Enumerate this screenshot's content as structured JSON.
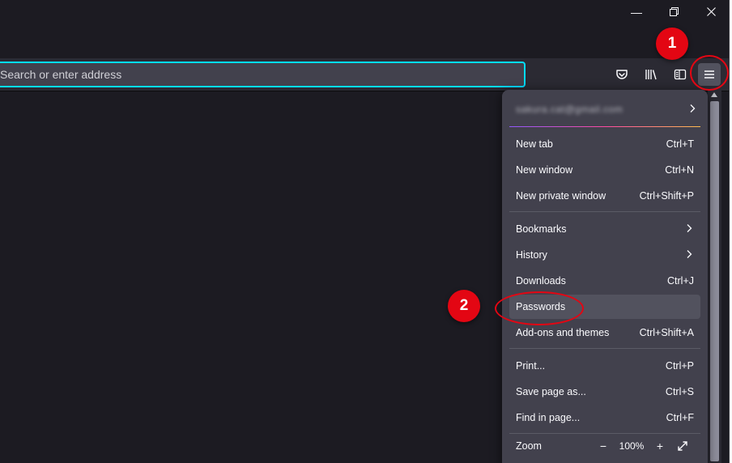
{
  "window_controls": {
    "minimize": "—",
    "restore": "❐",
    "close": "✕"
  },
  "urlbar": {
    "placeholder": "Search or enter address"
  },
  "toolbar_icons": [
    "pocket-icon",
    "library-icon",
    "sidebar-icon",
    "hamburger-menu-icon"
  ],
  "menu": {
    "account_email": "sakura.cat@gmail.com",
    "items_group1": [
      {
        "label": "New tab",
        "shortcut": "Ctrl+T"
      },
      {
        "label": "New window",
        "shortcut": "Ctrl+N"
      },
      {
        "label": "New private window",
        "shortcut": "Ctrl+Shift+P"
      }
    ],
    "items_group2": [
      {
        "label": "Bookmarks",
        "shortcut": ""
      },
      {
        "label": "History",
        "shortcut": ""
      },
      {
        "label": "Downloads",
        "shortcut": "Ctrl+J"
      },
      {
        "label": "Passwords",
        "shortcut": ""
      },
      {
        "label": "Add-ons and themes",
        "shortcut": "Ctrl+Shift+A"
      }
    ],
    "items_group3": [
      {
        "label": "Print...",
        "shortcut": "Ctrl+P"
      },
      {
        "label": "Save page as...",
        "shortcut": "Ctrl+S"
      },
      {
        "label": "Find in page...",
        "shortcut": "Ctrl+F"
      }
    ],
    "zoom": {
      "label": "Zoom",
      "minus": "−",
      "value": "100%",
      "plus": "+"
    }
  },
  "annotations": {
    "step1": "1",
    "step2": "2",
    "color": "#e30613"
  },
  "colors": {
    "accent_focus": "#00ddff",
    "menu_bg": "#42414d",
    "window_bg": "#1c1b22"
  }
}
